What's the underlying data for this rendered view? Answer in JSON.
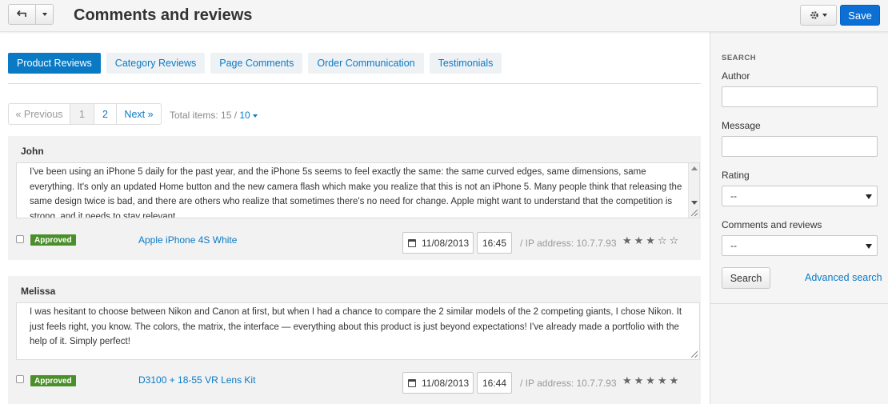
{
  "header": {
    "title": "Comments and reviews",
    "save_label": "Save"
  },
  "tabs": [
    {
      "label": "Product Reviews",
      "active": true
    },
    {
      "label": "Category Reviews",
      "active": false
    },
    {
      "label": "Page Comments",
      "active": false
    },
    {
      "label": "Order Communication",
      "active": false
    },
    {
      "label": "Testimonials",
      "active": false
    }
  ],
  "pagination": {
    "prev_label": "« Previous",
    "pages": [
      "1",
      "2"
    ],
    "current_page": "1",
    "next_label": "Next »",
    "total_label": "Total items: 15 / ",
    "per_page": "10"
  },
  "reviews": [
    {
      "author": "John",
      "message": "I've been using an iPhone 5 daily for the past year, and the iPhone 5s seems to feel exactly the same: the same curved edges, same dimensions, same everything. It's only an updated Home button and the new camera flash which make you realize that this is not an iPhone 5.  Many people think that releasing the same design twice is bad, and there are others who realize that sometimes there's no need for change. Apple might want to understand that the competition is strong, and it needs to stay relevant.",
      "status": "Approved",
      "product": "Apple iPhone 4S White",
      "date": "11/08/2013",
      "time": "16:45",
      "ip": "/ IP address: 10.7.7.93",
      "rating": 3,
      "stars": "★★★☆☆"
    },
    {
      "author": "Melissa",
      "message": "I was hesitant to choose between Nikon and Canon at first, but when I had a chance to compare the 2 similar models of the 2 competing giants, I chose Nikon. It just feels right, you know. The colors, the matrix, the interface — everything about this product is just beyond expectations! I've already made a portfolio with the help of it. Simply perfect!",
      "status": "Approved",
      "product": "D3100 + 18-55 VR Lens Kit",
      "date": "11/08/2013",
      "time": "16:44",
      "ip": "/ IP address: 10.7.7.93",
      "rating": 5,
      "stars": "★★★★★"
    }
  ],
  "sidebar": {
    "heading": "SEARCH",
    "author_label": "Author",
    "author_value": "",
    "message_label": "Message",
    "message_value": "",
    "rating_label": "Rating",
    "rating_value": "--",
    "type_label": "Comments and reviews",
    "type_value": "--",
    "search_label": "Search",
    "advanced_label": "Advanced search"
  },
  "colors": {
    "primary": "#0b7ac4",
    "save": "#0b6fd6",
    "approved": "#4a8f2a"
  }
}
